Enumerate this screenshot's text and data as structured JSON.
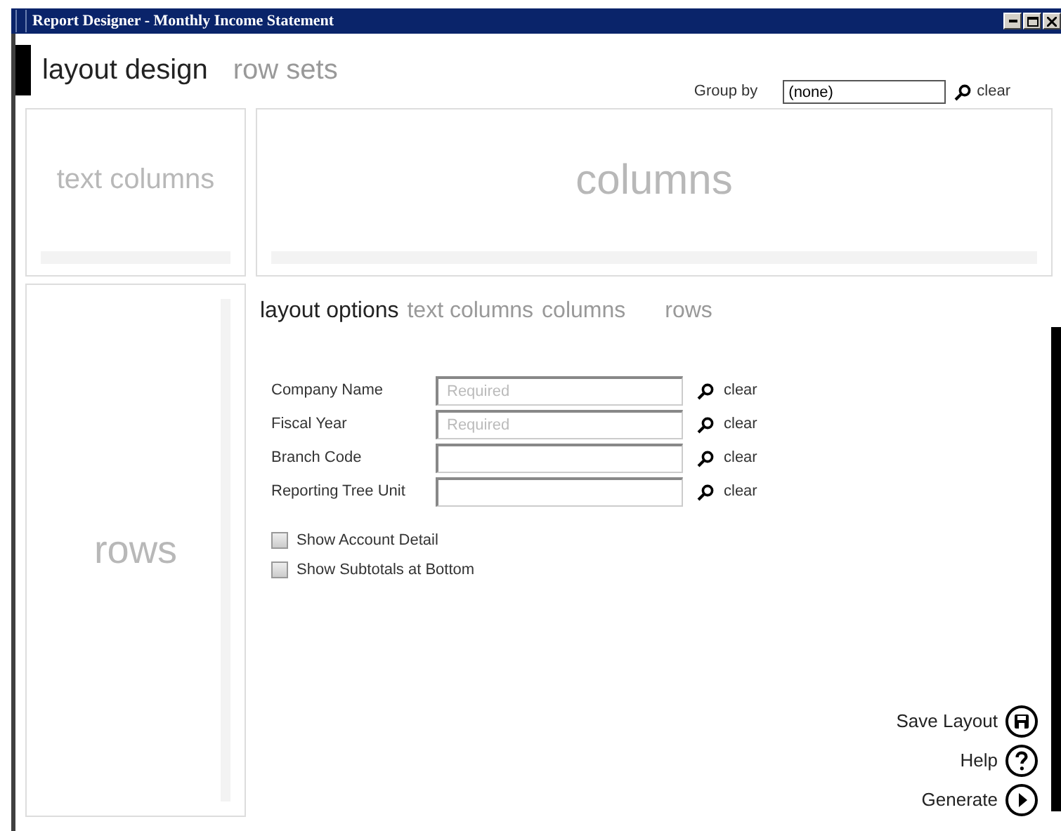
{
  "window": {
    "title": "Report Designer - Monthly Income Statement"
  },
  "tabs": [
    {
      "label": "layout design",
      "selected": true
    },
    {
      "label": "row sets",
      "selected": false
    }
  ],
  "group_by": {
    "label": "Group by",
    "value": "(none)",
    "clear": "clear"
  },
  "panels": {
    "text_columns": "text columns",
    "columns": "columns",
    "rows": "rows"
  },
  "option_tabs": [
    {
      "label": "layout options",
      "selected": true
    },
    {
      "label": "text columns",
      "selected": false
    },
    {
      "label": "columns",
      "selected": false
    },
    {
      "label": "rows",
      "selected": false
    }
  ],
  "fields": [
    {
      "label": "Company Name",
      "placeholder": "Required",
      "clear": "clear"
    },
    {
      "label": "Fiscal Year",
      "placeholder": "Required",
      "clear": "clear"
    },
    {
      "label": "Branch Code",
      "clear": "clear"
    },
    {
      "label": "Reporting Tree Unit",
      "clear": "clear"
    }
  ],
  "checkboxes": [
    {
      "label": "Show Account Detail",
      "checked": false
    },
    {
      "label": "Show Subtotals at Bottom",
      "checked": false
    }
  ],
  "actions": [
    {
      "label": "Save Layout",
      "kind": "save"
    },
    {
      "label": "Help",
      "kind": "help"
    },
    {
      "label": "Generate",
      "kind": "generate"
    }
  ]
}
